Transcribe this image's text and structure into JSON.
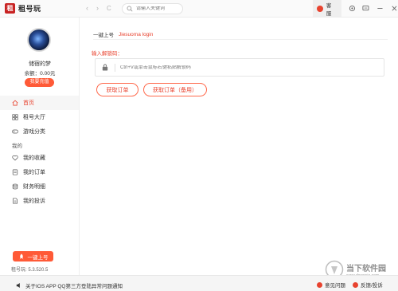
{
  "app": {
    "logo_text": "租号玩"
  },
  "titlebar": {
    "search_placeholder": "请输入关键词",
    "service_label": "客服",
    "nav_back": "‹",
    "nav_forward": "›",
    "nav_refresh": "C"
  },
  "sidebar": {
    "username": "储宿的梦",
    "balance_label": "余额：",
    "balance_value": "0.00元",
    "recharge_button": "我要充值",
    "menu_main": [
      {
        "label": "首页"
      },
      {
        "label": "租号大厅"
      },
      {
        "label": "游戏分类"
      }
    ],
    "section_mine": "我的",
    "menu_mine": [
      {
        "label": "我的收藏"
      },
      {
        "label": "我的订单"
      },
      {
        "label": "财务明细"
      },
      {
        "label": "我的投诉"
      }
    ],
    "quick_login_button": "一键上号",
    "version": "租号玩: 5.3.520.5"
  },
  "main": {
    "section_title": "一键上号",
    "section_subtitle": "Jiesuoma login",
    "field_label": "输入解锁码：",
    "code_placeholder": "Ctrl+V或单击鼠标右键粘贴解锁码",
    "get_order_button": "获取订单",
    "get_order_backup_button": "获取订单（备用）"
  },
  "statusbar": {
    "notice": "关于IOS APP QQ第三方登陆异常问题通知",
    "feedback": "意见问题",
    "complaint": "反馈/投诉"
  },
  "watermark": {
    "cn": "当下软件园",
    "url": "www.downxia.com"
  },
  "colors": {
    "accent": "#e8432f",
    "button": "#ff5a37"
  }
}
